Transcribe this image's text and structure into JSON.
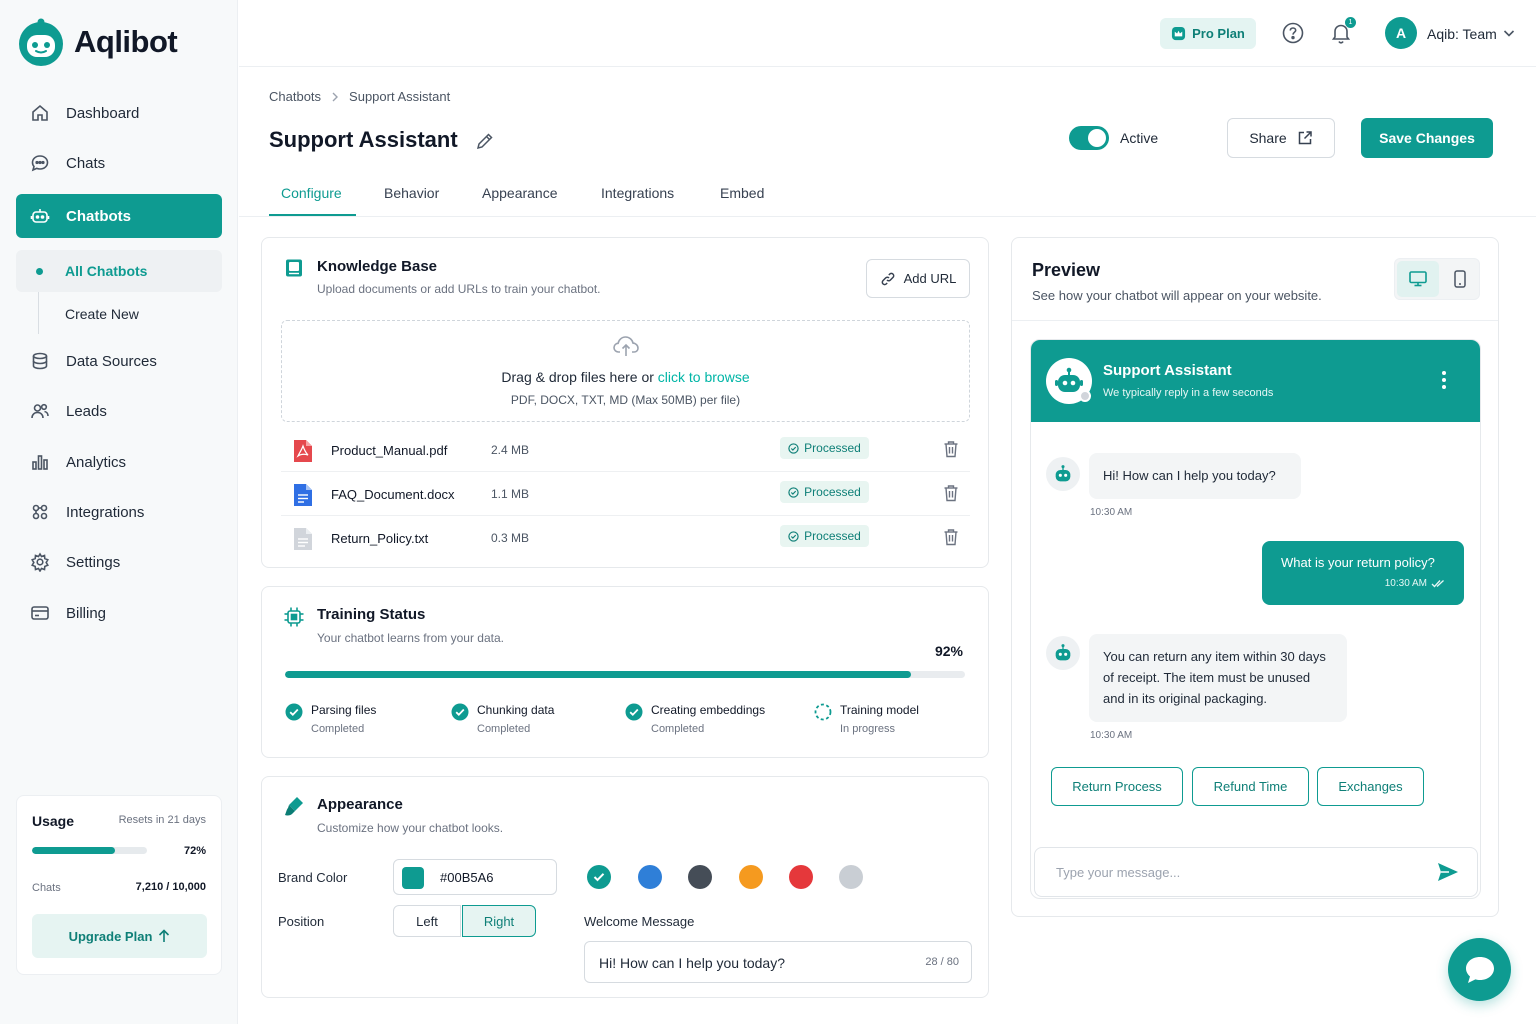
{
  "app": {
    "brand": "Aqlibot",
    "accent": "#0E9B91"
  },
  "sidebar": {
    "items": [
      {
        "label": "Dashboard",
        "icon": "home-icon"
      },
      {
        "label": "Chats",
        "icon": "chat-icon"
      },
      {
        "label": "Chatbots",
        "icon": "bot-icon",
        "active": true
      },
      {
        "label": "Data Sources",
        "icon": "database-icon"
      },
      {
        "label": "Leads",
        "icon": "users-icon"
      },
      {
        "label": "Analytics",
        "icon": "bar-chart-icon"
      },
      {
        "label": "Integrations",
        "icon": "puzzle-icon"
      },
      {
        "label": "Settings",
        "icon": "gear-icon"
      },
      {
        "label": "Billing",
        "icon": "card-icon"
      }
    ],
    "sub_items": [
      {
        "label": "All Chatbots",
        "active": true
      },
      {
        "label": "Create New"
      }
    ],
    "usage": {
      "title": "Usage",
      "reset": "Resets in 21 days",
      "percent_label": "72%",
      "fraction": 0.72,
      "chats_label": "Chats",
      "chats_count": "7,210 / 10,000",
      "upgrade_label": "Upgrade Plan"
    }
  },
  "topbar": {
    "plan_label": "Pro Plan",
    "notification_count": "1",
    "avatar_initial": "A",
    "user_name": "Aqib: Team"
  },
  "header": {
    "breadcrumb": [
      "Chatbots",
      "Support Assistant"
    ],
    "title": "Support Assistant",
    "active_label": "Active",
    "share_label": "Share",
    "save_label": "Save Changes"
  },
  "tabs": [
    "Configure",
    "Behavior",
    "Appearance",
    "Integrations",
    "Embed"
  ],
  "knowledge_base": {
    "title": "Knowledge Base",
    "subtitle": "Upload documents or add URLs to train your chatbot.",
    "add_url_label": "Add URL",
    "drop_text": "Drag & drop files here or ",
    "browse_text": "click to browse",
    "drop_hint": "PDF, DOCX, TXT, MD (Max 50MB) per file)",
    "files": [
      {
        "name": "Product_Manual.pdf",
        "size": "2.4 MB",
        "status": "Processed",
        "icon": "pdf-file-icon",
        "color": "#E5484D"
      },
      {
        "name": "FAQ_Document.docx",
        "size": "1.1 MB",
        "status": "Processed",
        "icon": "doc-file-icon",
        "color": "#2F6FE4"
      },
      {
        "name": "Return_Policy.txt",
        "size": "0.3 MB",
        "status": "Processed",
        "icon": "txt-file-icon",
        "color": "#C9CED4"
      }
    ]
  },
  "training": {
    "title": "Training Status",
    "subtitle": "Your chatbot learns from your data.",
    "percent_label": "92%",
    "fraction": 0.92,
    "steps": [
      {
        "name": "Parsing files",
        "state": "Completed"
      },
      {
        "name": "Chunking data",
        "state": "Completed"
      },
      {
        "name": "Creating embeddings",
        "state": "Completed"
      },
      {
        "name": "Training model",
        "state": "In progress"
      }
    ]
  },
  "appearance": {
    "title": "Appearance",
    "subtitle": "Customize how your chatbot looks.",
    "brand_color_label": "Brand Color",
    "brand_color_hex": "#00B5A6",
    "swatches": [
      "#0E9B91",
      "#2F7FD8",
      "#454D57",
      "#F59A1F",
      "#E5383B",
      "#C9CED4"
    ],
    "position_label": "Position",
    "position_left": "Left",
    "position_right": "Right",
    "welcome_label": "Welcome Message",
    "welcome_text": "Hi! How can I help you today?",
    "welcome_count": "28 / 80"
  },
  "preview": {
    "title": "Preview",
    "subtitle": "See how your chatbot will appear on your website.",
    "bot_name": "Support Assistant",
    "bot_status": "We typically reply in a few seconds",
    "messages": [
      {
        "from": "bot",
        "text": "Hi! How can I help you today?",
        "time": "10:30 AM"
      },
      {
        "from": "user",
        "text": "What is your return policy?",
        "time": "10:30 AM"
      },
      {
        "from": "bot",
        "text": "You can return any item within 30 days of receipt. The item must be unused and in its original packaging.",
        "time": "10:30 AM"
      }
    ],
    "quick_replies": [
      "Return Process",
      "Refund Time",
      "Exchanges"
    ],
    "input_placeholder": "Type your message..."
  }
}
